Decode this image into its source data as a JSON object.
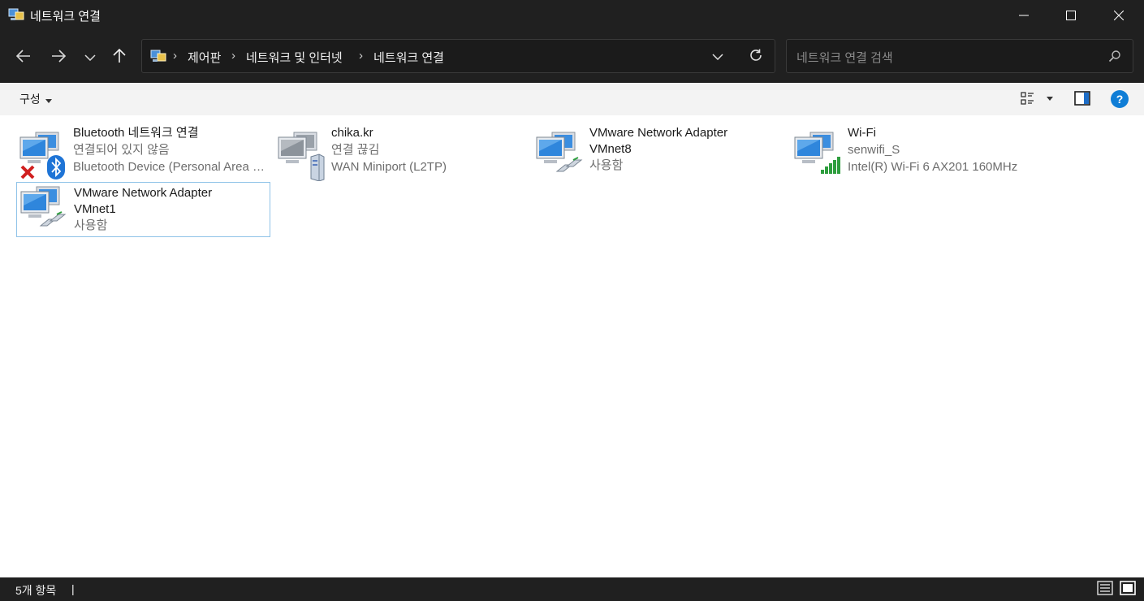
{
  "window": {
    "title": "네트워크 연결",
    "minimize_icon": "minimize-icon",
    "maximize_icon": "maximize-icon",
    "close_icon": "close-icon"
  },
  "nav": {
    "back_icon": "arrow-left-icon",
    "forward_icon": "arrow-right-icon",
    "recent_icon": "chevron-down-icon",
    "up_icon": "arrow-up-icon"
  },
  "address": {
    "icon": "control-panel-icon",
    "breadcrumbs": [
      "제어판",
      "네트워크 및 인터넷",
      "네트워크 연결"
    ],
    "separator": "›",
    "dropdown_icon": "chevron-down-icon",
    "refresh_icon": "refresh-icon"
  },
  "search": {
    "placeholder": "네트워크 연결 검색",
    "icon": "search-icon"
  },
  "command_bar": {
    "organize_label": "구성",
    "view_icon": "view-options-icon",
    "preview_pane_icon": "preview-pane-icon",
    "help_icon": "help-icon",
    "help_label": "?"
  },
  "connections": [
    {
      "name": "Bluetooth 네트워크 연결",
      "status": "연결되어 있지 않음",
      "device": "Bluetooth Device (Personal Area Network)",
      "icon": "bluetooth-network-icon",
      "overlay": "disconnected-x-icon",
      "selected": false
    },
    {
      "name": "chika.kr",
      "status": "연결 끊김",
      "device": "WAN Miniport (L2TP)",
      "icon": "vpn-network-icon",
      "overlay": "server-icon",
      "selected": false
    },
    {
      "name_line1": "VMware Network Adapter",
      "name_line2": "VMnet8",
      "status": "사용함",
      "icon": "ethernet-network-icon",
      "overlay": "network-cable-icon",
      "selected": false
    },
    {
      "name": "Wi-Fi",
      "status": "senwifi_S",
      "device": "Intel(R) Wi-Fi 6 AX201 160MHz",
      "icon": "wifi-network-icon",
      "overlay": "signal-bars-icon",
      "selected": false
    },
    {
      "name_line1": "VMware Network Adapter",
      "name_line2": "VMnet1",
      "status": "사용함",
      "icon": "ethernet-network-icon",
      "overlay": "network-cable-icon",
      "selected": true
    }
  ],
  "status_bar": {
    "item_count": "5개 항목",
    "caret": "|",
    "details_view_icon": "details-view-icon",
    "large_icons_view_icon": "large-icons-view-icon"
  },
  "colors": {
    "title_bar_bg": "#202020",
    "selection_border": "#8fc3e8",
    "help_blue": "#0f7dd6",
    "bluetooth_blue": "#1e74d6",
    "error_red": "#d01f1f",
    "signal_green": "#2e9e3e"
  }
}
